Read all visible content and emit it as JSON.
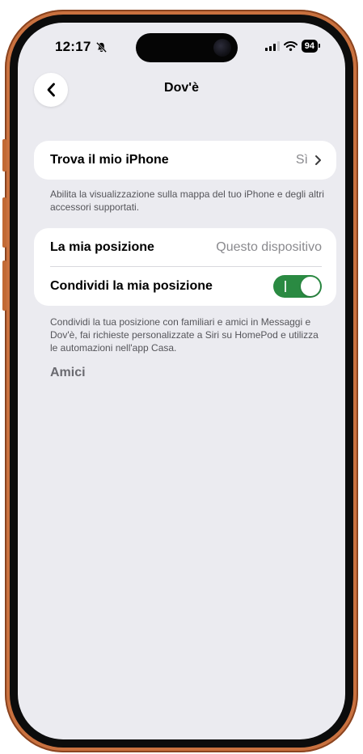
{
  "status_bar": {
    "time": "12:17",
    "battery": "94"
  },
  "nav": {
    "title": "Dov'è"
  },
  "find_my": {
    "label": "Trova il mio iPhone",
    "value": "Sì",
    "footnote": "Abilita la visualizzazione sulla mappa del tuo iPhone e degli altri accessori supportati."
  },
  "location": {
    "my_location_label": "La mia posizione",
    "my_location_value": "Questo dispositivo",
    "share_label": "Condividi la mia posizione",
    "share_on": true,
    "footnote": "Condividi la tua posizione con familiari e amici in Messaggi e Dov'è, fai richieste personalizzate a Siri su HomePod e utilizza le automazioni nell'app Casa."
  },
  "friends": {
    "header": "Amici"
  },
  "colors": {
    "toggle_on": "#2a8a42",
    "background": "#ebebf0",
    "frame": "#c9713f"
  }
}
